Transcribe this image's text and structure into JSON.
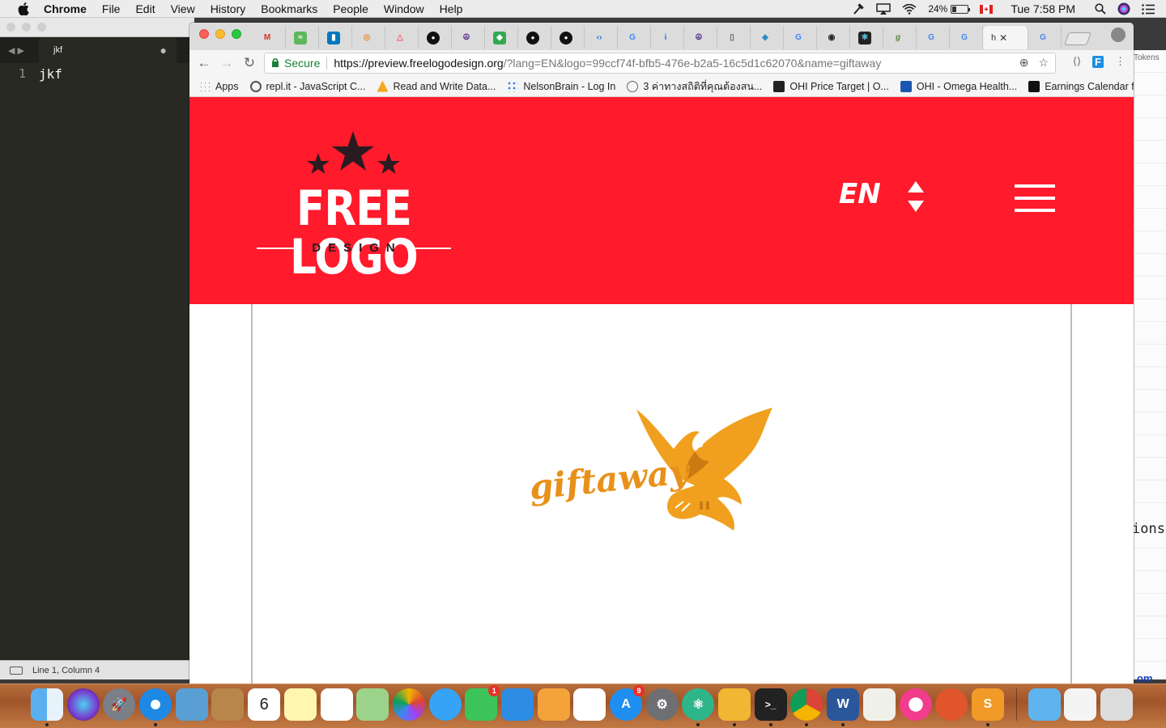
{
  "menubar": {
    "app_name": "Chrome",
    "items": [
      "File",
      "Edit",
      "View",
      "History",
      "Bookmarks",
      "People",
      "Window",
      "Help"
    ],
    "battery": "24%",
    "clock": "Tue 7:58 PM"
  },
  "editor": {
    "tab_name": "jkf",
    "line_number": "1",
    "code": "jkf",
    "status": "Line 1, Column 4"
  },
  "background_window": {
    "top_text": "Tokens",
    "side_text": "ions",
    "bottom_text": "om"
  },
  "browser": {
    "active_tab_label": "h",
    "omnibox": {
      "secure_label": "Secure",
      "url_scheme_host": "https://preview.freelogodesign.org",
      "url_path": "/?lang=EN&logo=99ccf74f-bfb5-476e-b2a5-16c5d1c62070&name=giftaway"
    },
    "bookmarks": [
      {
        "label": "Apps",
        "color": "#4285f4"
      },
      {
        "label": "repl.it - JavaScript C...",
        "color": "#555555"
      },
      {
        "label": "Read and Write Data...",
        "color": "#f5a623"
      },
      {
        "label": "NelsonBrain - Log In",
        "color": "#2b7de9"
      },
      {
        "label": "3 ค่าทางสถิติที่คุณต้องสน...",
        "color": "#666666"
      },
      {
        "label": "OHI Price Target | O...",
        "color": "#222222"
      },
      {
        "label": "OHI - Omega Health...",
        "color": "#1a56b0"
      },
      {
        "label": "Earnings Calendar fo...",
        "color": "#111111"
      }
    ]
  },
  "page": {
    "site_logo_title": "FREE LOGO",
    "site_logo_subtitle": "DESIGN",
    "language": "EN",
    "preview_logo_name": "giftaway",
    "colors": {
      "header_bg": "#ff1a2c",
      "logo_orange": "#f0a01e"
    }
  }
}
